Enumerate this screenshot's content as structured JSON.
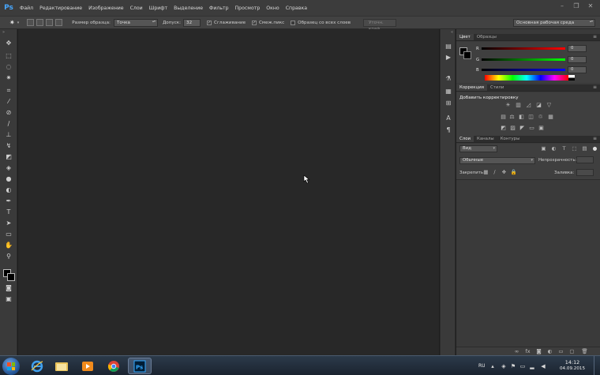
{
  "app": {
    "logo": "Ps"
  },
  "menu": [
    "Файл",
    "Редактирование",
    "Изображение",
    "Слои",
    "Шрифт",
    "Выделение",
    "Фильтр",
    "Просмотр",
    "Окно",
    "Справка"
  ],
  "window_controls": {
    "minimize": "–",
    "restore": "❐",
    "close": "✕"
  },
  "options_bar": {
    "sample_size_label": "Размер образца:",
    "sample_size_value": "Точка",
    "tolerance_label": "Допуск:",
    "tolerance_value": "32",
    "antialias_label": "Сглаживание",
    "antialias_checked": true,
    "contiguous_label": "Смеж.пикс",
    "contiguous_checked": true,
    "all_layers_label": "Образец со всех слоев",
    "all_layers_checked": false,
    "refine_edge_label": "Уточн. край...",
    "workspace_value": "Основная рабочая среда"
  },
  "tools": [
    "move-tool",
    "marquee-tool",
    "lasso-tool",
    "magic-wand-tool",
    "crop-tool",
    "eyedropper-tool",
    "healing-tool",
    "brush-tool",
    "stamp-tool",
    "history-brush-tool",
    "eraser-tool",
    "gradient-tool",
    "blur-tool",
    "dodge-tool",
    "pen-tool",
    "type-tool",
    "path-select-tool",
    "shape-tool",
    "hand-tool",
    "zoom-tool"
  ],
  "colors": {
    "foreground": "#000000",
    "background": "#000000",
    "accent": "#48a8ff"
  },
  "color_panel": {
    "tabs": [
      "Цвет",
      "Образцы"
    ],
    "channels": [
      {
        "label": "R",
        "value": "0",
        "color": "#d43c3c"
      },
      {
        "label": "G",
        "value": "0",
        "color": "#3cc43c"
      },
      {
        "label": "B",
        "value": "0",
        "color": "#3c6cd4"
      }
    ]
  },
  "adjustments_panel": {
    "tabs": [
      "Коррекция",
      "Стили"
    ],
    "title": "Добавить корректировку"
  },
  "layers_panel": {
    "tabs": [
      "Слои",
      "Каналы",
      "Контуры"
    ],
    "filter_value": "Вид",
    "blend_mode": "Обычные",
    "opacity_label": "Непрозрачность:",
    "lock_label": "Закрепить:",
    "fill_label": "Заливка:"
  },
  "taskbar": {
    "apps": [
      "internet-explorer",
      "file-explorer",
      "media-player",
      "chrome",
      "photoshop"
    ],
    "active_app": "photoshop",
    "language": "RU",
    "time": "14:12",
    "date": "04.09.2015"
  }
}
